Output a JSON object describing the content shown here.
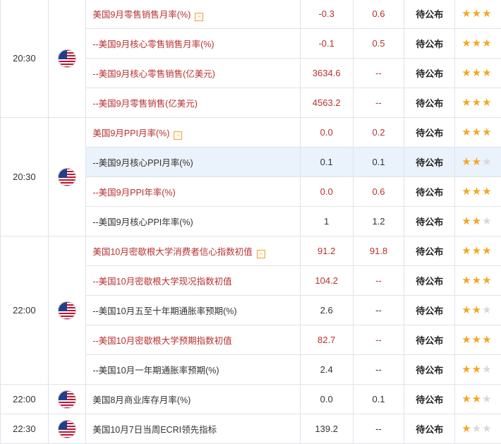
{
  "status_label": "待公布",
  "toggle_symbol": "-",
  "groups": [
    {
      "time": "20:30",
      "country": "US",
      "rows": [
        {
          "name": "美国9月零售销售月率(%)",
          "previous": "-0.3",
          "forecast": "0.6",
          "stars": 3,
          "color": "red",
          "toggle": true
        },
        {
          "name": "--美国9月核心零售销售月率(%)",
          "previous": "-0.1",
          "forecast": "0.5",
          "stars": 3,
          "color": "red"
        },
        {
          "name": "--美国9月核心零售销售(亿美元)",
          "previous": "3634.6",
          "forecast": "--",
          "stars": 3,
          "color": "red"
        },
        {
          "name": "--美国9月零售销售(亿美元)",
          "previous": "4563.2",
          "forecast": "--",
          "stars": 3,
          "color": "red"
        }
      ]
    },
    {
      "time": "20:30",
      "country": "US",
      "rows": [
        {
          "name": "美国9月PPI月率(%)",
          "previous": "0.0",
          "forecast": "0.2",
          "stars": 3,
          "color": "red",
          "toggle": true
        },
        {
          "name": "--美国9月核心PPI月率(%)",
          "previous": "0.1",
          "forecast": "0.1",
          "stars": 2,
          "color": "dark",
          "highlight": true
        },
        {
          "name": "--美国9月PPI年率(%)",
          "previous": "0.0",
          "forecast": "0.6",
          "stars": 3,
          "color": "red"
        },
        {
          "name": "--美国9月核心PPI年率(%)",
          "previous": "1",
          "forecast": "1.2",
          "stars": 2,
          "color": "dark"
        }
      ]
    },
    {
      "time": "22:00",
      "country": "US",
      "rows": [
        {
          "name": "美国10月密歇根大学消费者信心指数初值",
          "previous": "91.2",
          "forecast": "91.8",
          "stars": 3,
          "color": "red",
          "toggle": true
        },
        {
          "name": "--美国10月密歇根大学现况指数初值",
          "previous": "104.2",
          "forecast": "--",
          "stars": 3,
          "color": "red"
        },
        {
          "name": "--美国10月五至十年期通胀率预期(%)",
          "previous": "2.6",
          "forecast": "--",
          "stars": 2,
          "color": "dark"
        },
        {
          "name": "--美国10月密歇根大学预期指数初值",
          "previous": "82.7",
          "forecast": "--",
          "stars": 3,
          "color": "red"
        },
        {
          "name": "--美国10月一年期通胀率预期(%)",
          "previous": "2.4",
          "forecast": "--",
          "stars": 2,
          "color": "dark"
        }
      ]
    },
    {
      "time": "22:00",
      "country": "US",
      "rows": [
        {
          "name": "美国8月商业库存月率(%)",
          "previous": "0.0",
          "forecast": "0.1",
          "stars": 2,
          "color": "dark"
        }
      ]
    },
    {
      "time": "22:30",
      "country": "US",
      "rows": [
        {
          "name": "美国10月7日当周ECRI领先指标",
          "previous": "139.2",
          "forecast": "--",
          "stars": 1,
          "color": "dark"
        }
      ]
    }
  ],
  "colors": {
    "important": "#b8312f",
    "star_on": "#f5a623",
    "star_off": "#d8d8d8",
    "highlight": "#eaf2fc"
  }
}
